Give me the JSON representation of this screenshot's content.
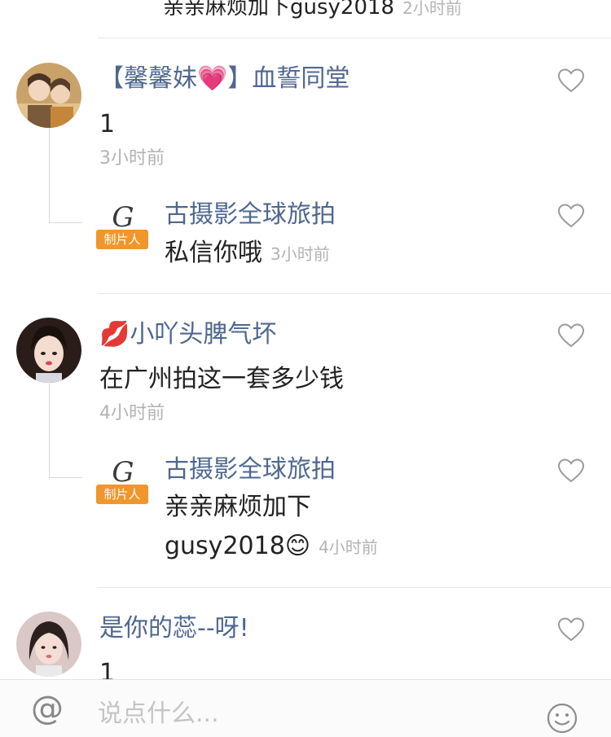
{
  "top_partial": {
    "text": "亲亲麻烦加下gusy2018",
    "time": "2小时前"
  },
  "comments": [
    {
      "username": "【馨馨妹💗】血誓同堂",
      "content": "1",
      "time": "3小时前",
      "reply": {
        "username": "古摄影全球旅拍",
        "badge": "制片人",
        "logo": "G",
        "content": "私信你哦",
        "time": "3小时前"
      }
    },
    {
      "username": "💋小吖头脾气坏",
      "content": "在广州拍这一套多少钱",
      "time": "4小时前",
      "reply": {
        "username": "古摄影全球旅拍",
        "badge": "制片人",
        "logo": "G",
        "content_line1": "亲亲麻烦加下",
        "content_line2": "gusy2018😊",
        "time": "4小时前"
      }
    },
    {
      "username": "是你的蕊--呀!",
      "content": "1"
    }
  ],
  "input_bar": {
    "placeholder": "说点什么...",
    "at_symbol": "@"
  },
  "icons": {
    "like": "heart-outline-icon",
    "mention": "at-icon",
    "emoji": "emoji-icon"
  },
  "colors": {
    "username": "#4f6790",
    "badge": "#f0962a",
    "meta": "#b3b3b3"
  }
}
